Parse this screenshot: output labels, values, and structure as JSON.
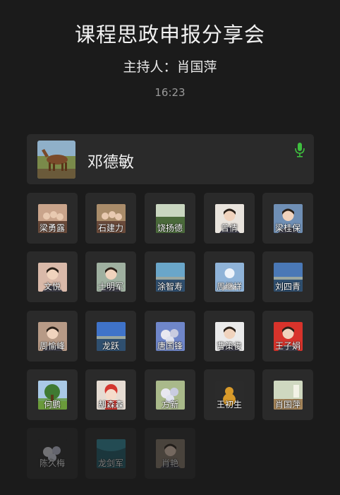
{
  "meeting": {
    "title": "课程思政申报分享会",
    "host": "主持人：肖国萍",
    "time": "16:23"
  },
  "speaker": {
    "name": "邓德敏",
    "avatar": "horse-photo",
    "mic_icon": "microphone-icon",
    "mic_color": "#3fbf3f"
  },
  "participants": [
    {
      "name": "梁勇露",
      "avatar": "group-photo",
      "color": "#c9a48b"
    },
    {
      "name": "石建力",
      "avatar": "group-photo",
      "color": "#a98c6a"
    },
    {
      "name": "饶扬德",
      "avatar": "outdoor-photo",
      "color": "#8aa08a"
    },
    {
      "name": "曾倩",
      "avatar": "portrait-photo",
      "color": "#e9e4dd"
    },
    {
      "name": "梁桂保",
      "avatar": "portrait-photo",
      "color": "#6f8fb5"
    },
    {
      "name": "文悦",
      "avatar": "portrait-photo",
      "color": "#d9b9a9"
    },
    {
      "name": "士明军",
      "avatar": "portrait-photo",
      "color": "#9fb0a0"
    },
    {
      "name": "涂智寿",
      "avatar": "lake-photo",
      "color": "#6aa6c9"
    },
    {
      "name": "周继祥",
      "avatar": "default-avatar",
      "color": "#8fb3d8"
    },
    {
      "name": "刘四青",
      "avatar": "sea-photo",
      "color": "#4a78b6"
    },
    {
      "name": "周愉峰",
      "avatar": "portrait-photo",
      "color": "#b79a86"
    },
    {
      "name": "龙跃",
      "avatar": "sky-photo",
      "color": "#3f73c9"
    },
    {
      "name": "唐国锋",
      "avatar": "flower-photo",
      "color": "#6f86c9"
    },
    {
      "name": "曹策俊",
      "avatar": "portrait-photo",
      "color": "#eaeaea"
    },
    {
      "name": "王子娟",
      "avatar": "portrait-photo",
      "color": "#d8332b"
    },
    {
      "name": "何鹏",
      "avatar": "tree-photo",
      "color": "#6fa05a"
    },
    {
      "name": "胡森森",
      "avatar": "cartoon-photo",
      "color": "#e6dcd3"
    },
    {
      "name": "方新",
      "avatar": "flower-photo",
      "color": "#a9b98a"
    },
    {
      "name": "王初生",
      "avatar": "gourd-photo",
      "color": "#2b2b2b"
    },
    {
      "name": "肖国萍",
      "avatar": "room-photo",
      "color": "#cfd8c0"
    },
    {
      "name": "陈久梅",
      "avatar": "flower-photo",
      "color": "#2a2a2a"
    },
    {
      "name": "龙剑军",
      "avatar": "underwater-photo",
      "color": "#1d5d6b"
    },
    {
      "name": "肖艳",
      "avatar": "portrait-photo",
      "color": "#8a7a6a"
    }
  ]
}
